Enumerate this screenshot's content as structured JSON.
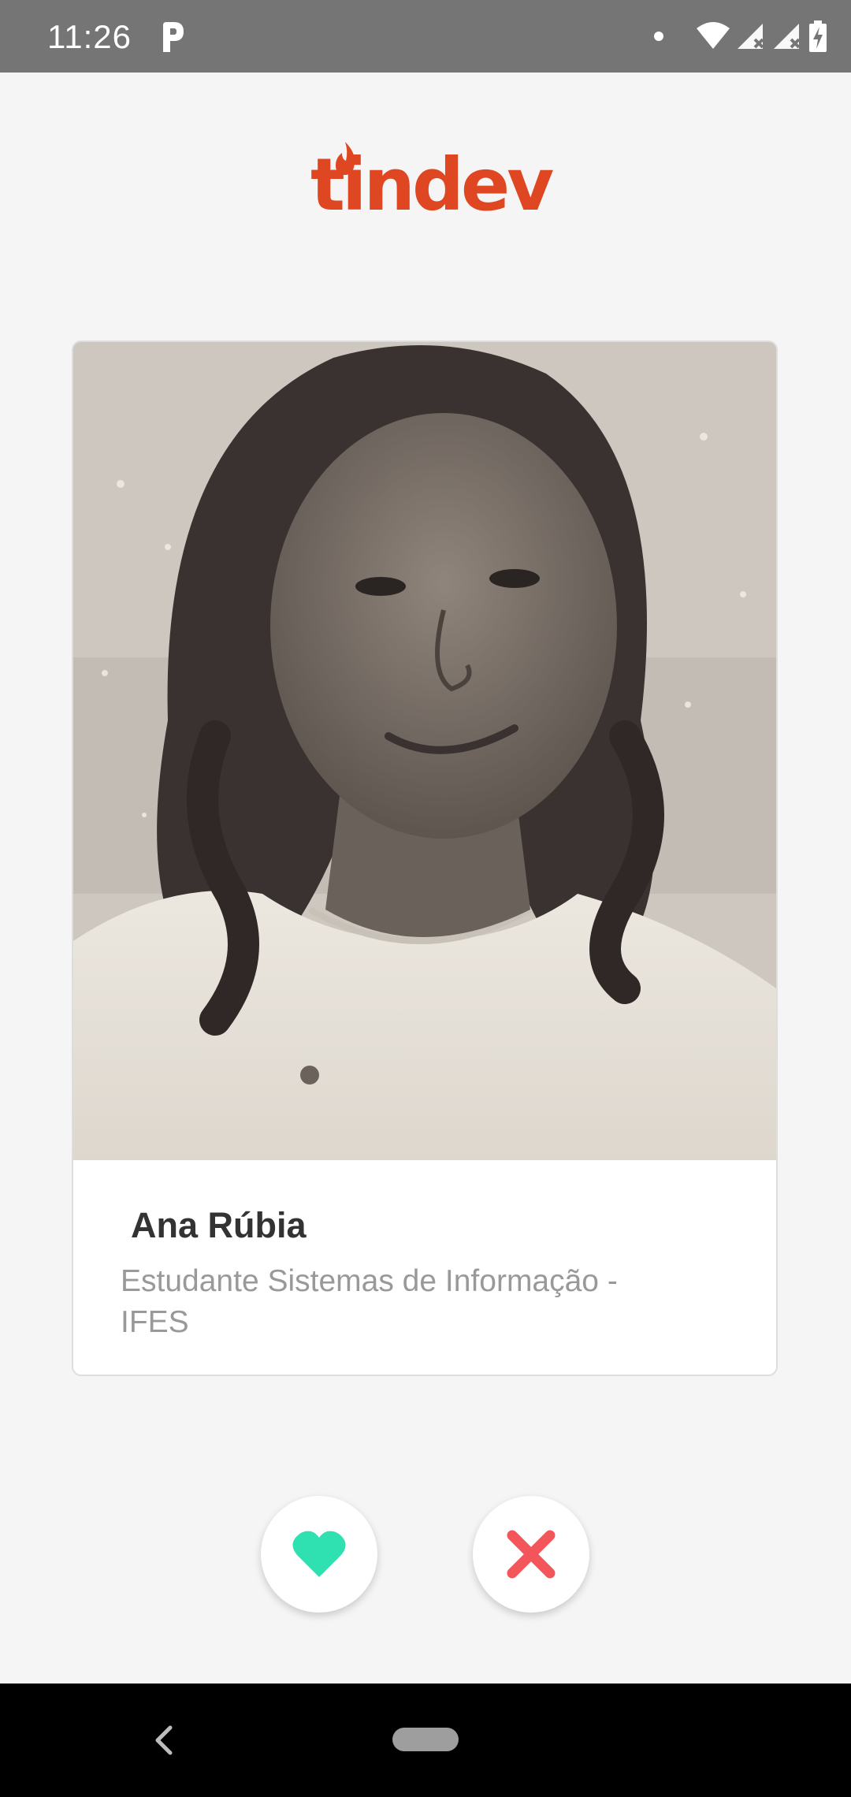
{
  "status_bar": {
    "time": "11:26"
  },
  "header": {
    "logo_text": "tindev",
    "logo_color": "#df4723"
  },
  "card": {
    "name": "Ana Rúbia",
    "bio": " Estudante Sistemas de Informação -\nIFES"
  },
  "actions": {
    "like_icon": "heart-icon",
    "like_color": "#2fe0b0",
    "dislike_icon": "close-icon",
    "dislike_color": "#f2555a"
  },
  "navigation": {
    "back_icon": "chevron-left-icon",
    "home_icon": "home-pill"
  }
}
